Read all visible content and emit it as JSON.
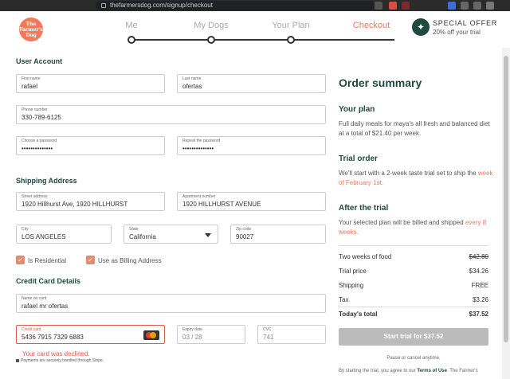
{
  "browser": {
    "url": "thefarmersdog.com/signup/checkout"
  },
  "header": {
    "logo_text": "The Farmer's Dog",
    "steps": [
      "Me",
      "My Dogs",
      "Your Plan",
      "Checkout"
    ],
    "active_step": "Checkout",
    "offer_title": "SPECIAL OFFER",
    "offer_sub": "20% off your trial",
    "offer_icon": "gift-icon"
  },
  "form": {
    "user_account_title": "User Account",
    "first_name": {
      "label": "First name",
      "value": "rafael"
    },
    "last_name": {
      "label": "Last name",
      "value": "ofertas"
    },
    "phone": {
      "label": "Phone number",
      "value": "330-789-6125"
    },
    "password": {
      "label": "Choose a password",
      "value": "••••••••••••••"
    },
    "repeat_password": {
      "label": "Repeat the password",
      "value": "••••••••••••••"
    },
    "shipping_title": "Shipping Address",
    "street": {
      "label": "Street address",
      "value": "1920 Hillhurst Ave, 1920 HILLHURST"
    },
    "apartment": {
      "label": "Apartment number",
      "value": "1920 HILLHURST AVENUE"
    },
    "city": {
      "label": "City",
      "value": "LOS ANGELES"
    },
    "state": {
      "label": "State",
      "value": "California"
    },
    "zip": {
      "label": "Zip code",
      "value": "90027"
    },
    "residential_label": "Is Residential",
    "billing_label": "Use as Billing Address",
    "credit_title": "Credit Card Details",
    "name_on_card": {
      "label": "Name on card",
      "value": "rafael mr ofertas"
    },
    "card": {
      "label": "Credit card",
      "value": "5436 7915 7329 6883"
    },
    "expiry": {
      "label": "Expiry date",
      "value": "03 / 28"
    },
    "cvc": {
      "label": "CVC",
      "value": "741"
    },
    "error": "Your card was declined.",
    "secure_note": "Payments are securely handled through Stripe."
  },
  "summary": {
    "title": "Order summary",
    "plan_title": "Your plan",
    "plan_text": "Full daily meals for maya's all fresh and balanced diet at a total of $21.40 per week.",
    "trial_title": "Trial order",
    "trial_text": "We'll start with a 2-week taste trial set to ship the",
    "trial_highlight": "week of February 1st.",
    "after_title": "After the trial",
    "after_text": "Your selected plan will be billed and shipped",
    "after_highlight": "every 8 weeks.",
    "rows": [
      {
        "label": "Two weeks of food",
        "value": "$42.80"
      },
      {
        "label": "Trial price",
        "value": "$34.26"
      },
      {
        "label": "Shipping",
        "value": "FREE"
      },
      {
        "label": "Tax",
        "value": "$3.26"
      }
    ],
    "total_label": "Today's total",
    "total_value": "$37.52",
    "button_label": "Start trial for $37.52",
    "cancel_text": "Pause or cancel anytime.",
    "terms_prefix": "By starting the trial, you agree to our",
    "terms_link": "Terms of Use",
    "terms_suffix": ". The Farmer's"
  },
  "colors": {
    "accent": "#f5785a",
    "brand": "#1e4b3e",
    "error": "#e05a4a"
  }
}
